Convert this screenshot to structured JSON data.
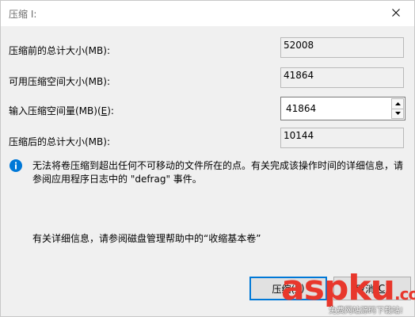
{
  "window": {
    "title": "压缩 I:"
  },
  "fields": {
    "total_before": {
      "label": "压缩前的总计大小(MB):",
      "value": "52008"
    },
    "available": {
      "label": "可用压缩空间大小(MB):",
      "value": "41864"
    },
    "amount": {
      "label_prefix": "输入压缩空间量(MB)(",
      "label_key": "E",
      "label_suffix": "):",
      "value": "41864"
    },
    "total_after": {
      "label": "压缩后的总计大小(MB):",
      "value": "10144"
    }
  },
  "info": {
    "icon": "info-icon",
    "text": "无法将卷压缩到超出任何不可移动的文件所在的点。有关完成该操作时间的详细信息，请参阅应用程序日志中的 \"defrag\" 事件。"
  },
  "help": {
    "text": "有关详细信息，请参阅磁盘管理帮助中的“收缩基本卷”"
  },
  "buttons": {
    "shrink_prefix": "压缩(",
    "shrink_key": "S",
    "shrink_suffix": ")",
    "cancel_prefix": "取消(",
    "cancel_key": "C",
    "cancel_suffix": ")"
  },
  "watermark": {
    "brand_main": "asp",
    "brand_ku": "ku",
    "brand_suffix": ".com",
    "tagline": "免费网站源码下载站!"
  },
  "colors": {
    "accent": "#0078d7",
    "info_icon": "#0078d7",
    "watermark": "#e8372c"
  }
}
